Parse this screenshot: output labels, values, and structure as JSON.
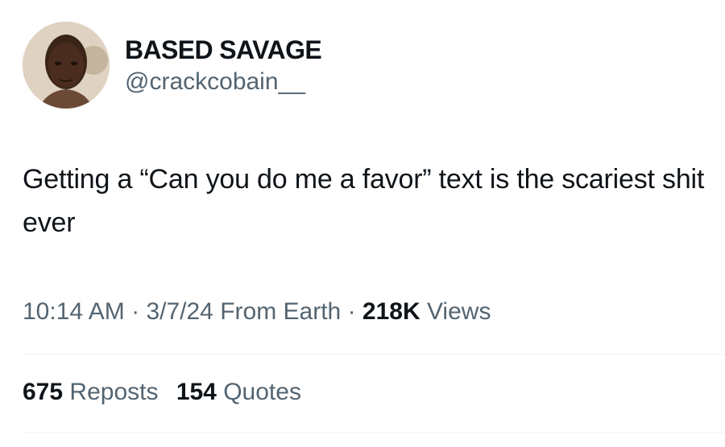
{
  "author": {
    "display_name": "BASED SAVAGE",
    "handle": "@crackcobain__",
    "avatar_icon": "profile-photo"
  },
  "tweet": {
    "text": "Getting a “Can you do me a favor” text is the scariest shit ever"
  },
  "meta": {
    "time": "10:14 AM",
    "separator_1": " · ",
    "date": "3/7/24",
    "source": "From Earth",
    "separator_2": " · ",
    "views_count": "218K",
    "views_label": "Views"
  },
  "stats": {
    "reposts_count": "675",
    "reposts_label": "Reposts",
    "quotes_count": "154",
    "quotes_label": "Quotes"
  },
  "colors": {
    "primary_text": "#0f1419",
    "secondary_text": "#536471",
    "divider": "#eff3f4"
  }
}
